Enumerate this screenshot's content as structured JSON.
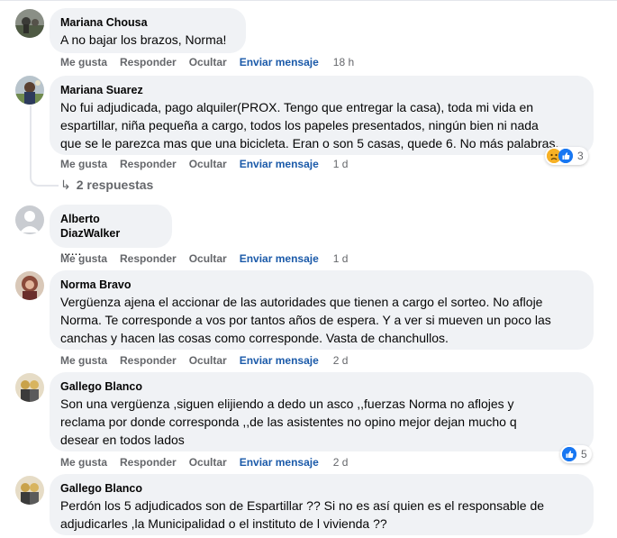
{
  "actions": {
    "like": "Me gusta",
    "reply": "Responder",
    "hide": "Ocultar",
    "send": "Enviar mensaje"
  },
  "comments": [
    {
      "author": "Mariana Chousa",
      "lines": [
        "A no bajar los brazos, Norma!"
      ],
      "time": "18 h"
    },
    {
      "author": "Mariana Suarez",
      "lines": [
        "No fui adjudicada, pago alquiler(PROX. Tengo que entregar la casa), toda mi vida en",
        "espartillar, niña pequeña a cargo, todos los papeles presentados, ningún bien ni nada",
        "que se le parezca mas que una bicicleta. Eran o son 5 casas, quede 6. No más palabras."
      ],
      "time": "1 d",
      "reactions": {
        "icons": [
          "sad-icon",
          "like-icon"
        ],
        "count": "3"
      },
      "replies": "2 respuestas"
    },
    {
      "author": "Alberto DiazWalker",
      "lines": [
        "......"
      ],
      "time": "1 d"
    },
    {
      "author": "Norma Bravo",
      "lines": [
        "Vergüenza ajena el accionar de las autoridades que tienen a cargo el sorteo. No afloje",
        "Norma. Te corresponde a vos por tantos años de espera. Y a ver si mueven un poco las",
        "canchas y hacen las cosas como corresponde. Vasta de chanchullos."
      ],
      "time": "2 d"
    },
    {
      "author": "Gallego Blanco",
      "lines": [
        "Son una vergüenza ,siguen elijiendo a dedo un asco ,,fuerzas Norma no aflojes y",
        "reclama por donde corresponda ,,de las asistentes no opino mejor dejan mucho q",
        "desear en todos lados"
      ],
      "time": "2 d",
      "reactions": {
        "icons": [
          "like-icon"
        ],
        "count": "5"
      }
    },
    {
      "author": "Gallego Blanco",
      "lines": [
        "Perdón los 5 adjudicados son de Espartillar ?? Si no es así quien es el responsable de",
        "adjudicarles ,la Municipalidad o el instituto de l vivienda ??"
      ]
    }
  ],
  "colors": {
    "bubble": "#f0f2f5",
    "action_text": "#65676b",
    "send_link": "#1b5aa9",
    "like_blue": "#1877f2",
    "sad_yellow": "#f7b125"
  }
}
